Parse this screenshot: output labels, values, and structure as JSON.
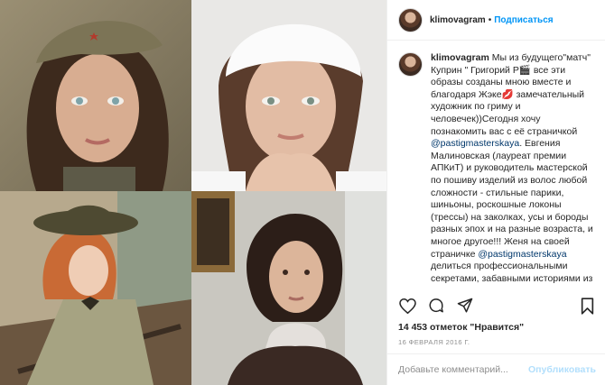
{
  "post": {
    "username": "klimovagram",
    "follow_label": "Подписаться",
    "separator": "•",
    "photo_alts": [
      "Женщина в военной пилотке",
      "Женщина в белом платке",
      "Рыжая женщина в шляпе",
      "Женщина в кружевном воротнике"
    ]
  },
  "caption": {
    "username": "klimovagram",
    "text_1": " Мы из будущего\"матч\" Куприн \" Григорий Р🎬 все эти образы созданы мною вместе и благодаря Жэке💋 замечательный художник по гриму и человечек))Сегодня хочу познакомить вас с её страничкой ",
    "mention_1": "@pastigmasterskaya",
    "text_2": ". Евгения Малиновская (лауреат премии АПКиТ) и руководитель мастерской по пошиву изделий из волос любой сложности - стильные парики, шиньоны, роскошные локоны (трессы) на заколках, усы и бороды разных эпох и на разные возраста, и многое другое!!! Женя на своей страничке ",
    "mention_2": "@pastigmasterskaya",
    "text_3": " делиться профессиональными секретами, забавными историями из жизни, интересными моментами"
  },
  "engagement": {
    "likes": "14 453 отметок \"Нравится\"",
    "date": "16 ФЕВРАЛЯ 2016 Г."
  },
  "comment_box": {
    "placeholder": "Добавьте комментарий...",
    "publish_label": "Опубликовать"
  },
  "icons": [
    "heart-icon",
    "comment-icon",
    "share-icon",
    "bookmark-icon"
  ],
  "colors": {
    "link": "#0095f6",
    "mention": "#00376b",
    "muted": "#8e8e8e",
    "publish_disabled": "#b2dffc"
  }
}
